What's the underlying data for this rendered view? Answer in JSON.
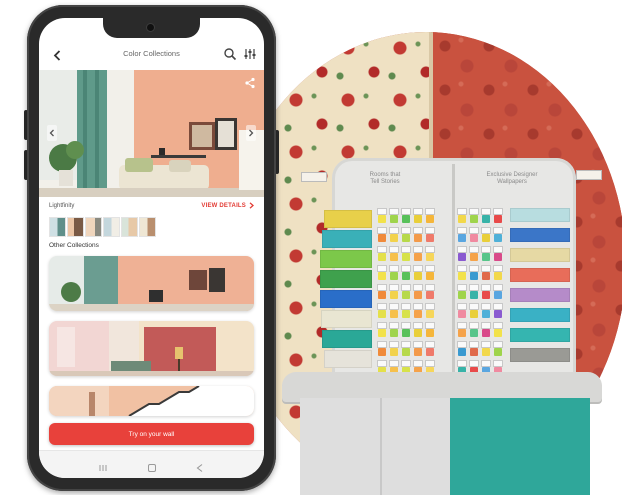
{
  "app": {
    "title": "Color Collections",
    "collection_name": "Lightfinity",
    "view_details_label": "VIEW DETAILS",
    "other_collections_label": "Other Collections",
    "cta_label": "Try on your wall"
  },
  "display_stand": {
    "left_header": "Rooms that\nTell Stories",
    "right_header": "Exclusive Designer\nWallpapers"
  },
  "icons": {
    "back": "chevron-left-icon",
    "search": "search-icon",
    "filter": "filter-sliders-icon",
    "share": "share-icon",
    "prev": "chevron-left-icon",
    "next": "chevron-right-icon",
    "nav_recent": "recent-apps-icon",
    "nav_home": "home-icon",
    "nav_back": "back-nav-icon"
  },
  "colors": {
    "accent": "#e8413b",
    "accent_text": "#e23a33",
    "phone_body": "#2a2a2a"
  }
}
